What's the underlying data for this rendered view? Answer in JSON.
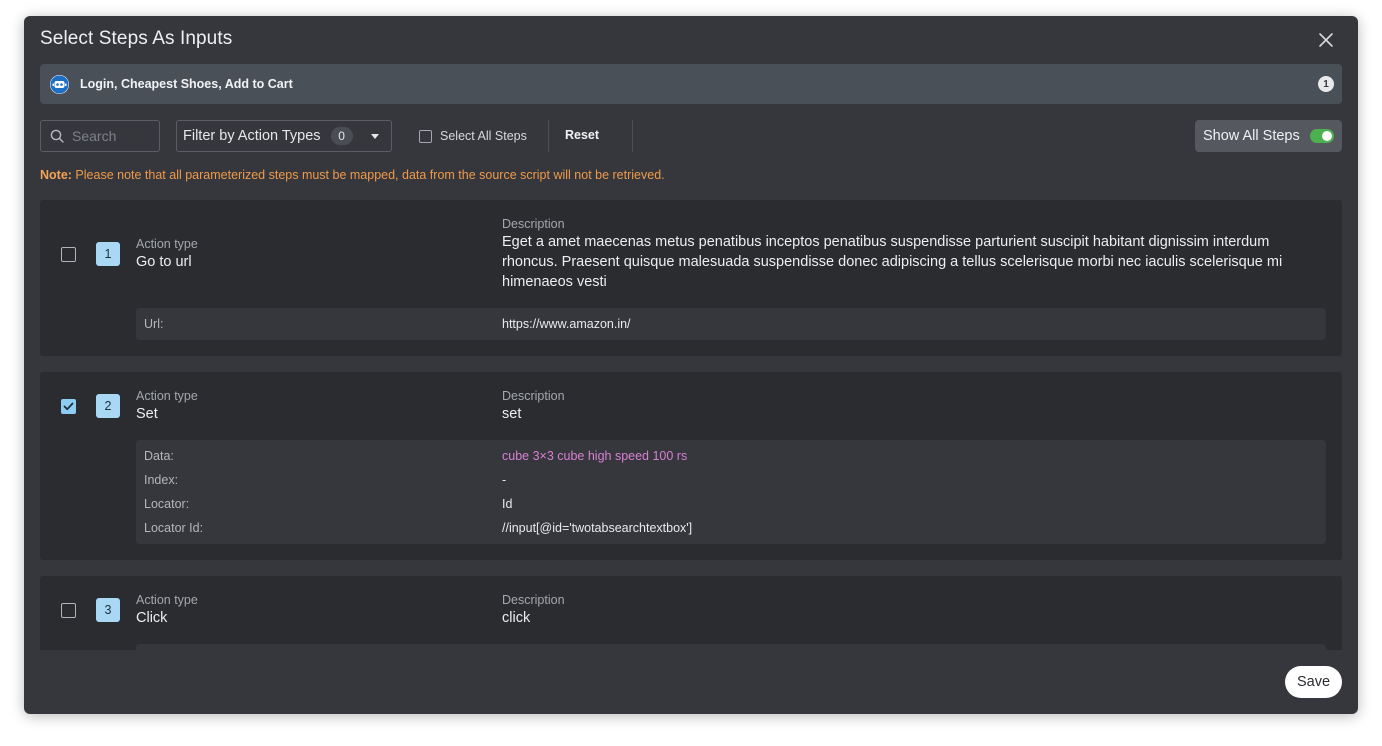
{
  "modal": {
    "title": "Select Steps As Inputs",
    "close_icon": "close-icon"
  },
  "script": {
    "name": "Login, Cheapest Shoes, Add to Cart",
    "count": "1",
    "logo_icon": "robot-logo-icon"
  },
  "toolbar": {
    "search_placeholder": "Search",
    "filter_label": "Filter by Action Types",
    "filter_count": "0",
    "select_all_label": "Select All Steps",
    "select_all_checked": false,
    "reset_label": "Reset",
    "show_all_label": "Show All Steps",
    "show_all_on": true
  },
  "note": {
    "prefix": "Note:",
    "text": " Please note that all parameterized steps must be mapped, data from the source script will not be retrieved."
  },
  "labels": {
    "action_type": "Action type",
    "description": "Description"
  },
  "steps": [
    {
      "number": "1",
      "checked": false,
      "action_type": "Go to url",
      "description": "Eget a amet maecenas metus penatibus inceptos penatibus suspendisse parturient suscipit habitant dignissim interdum rhoncus. Praesent quisque malesuada suspendisse donec adipiscing a tellus scelerisque morbi nec iaculis scelerisque mi himenaeos vesti",
      "params": [
        {
          "key": "Url:",
          "value": "https://www.amazon.in/"
        }
      ]
    },
    {
      "number": "2",
      "checked": true,
      "action_type": "Set",
      "description": "set",
      "params": [
        {
          "key": "Data:",
          "value": "cube 3×3 cube high speed 100 rs"
        },
        {
          "key": "Index:",
          "value": "-"
        },
        {
          "key": "Locator:",
          "value": "Id"
        },
        {
          "key": "Locator Id:",
          "value": "//input[@id='twotabsearchtextbox']"
        }
      ]
    },
    {
      "number": "3",
      "checked": false,
      "action_type": "Click",
      "description": "click",
      "params": []
    }
  ],
  "colors": {
    "modal_bg": "#35373c",
    "card_bg": "#2a2c30",
    "accent_blue": "#a9d8f5",
    "toggle_on": "#4caf50",
    "note_orange": "#ef9a4a",
    "param_pink": "#d97fd4"
  },
  "footer": {
    "save_label": "Save"
  }
}
